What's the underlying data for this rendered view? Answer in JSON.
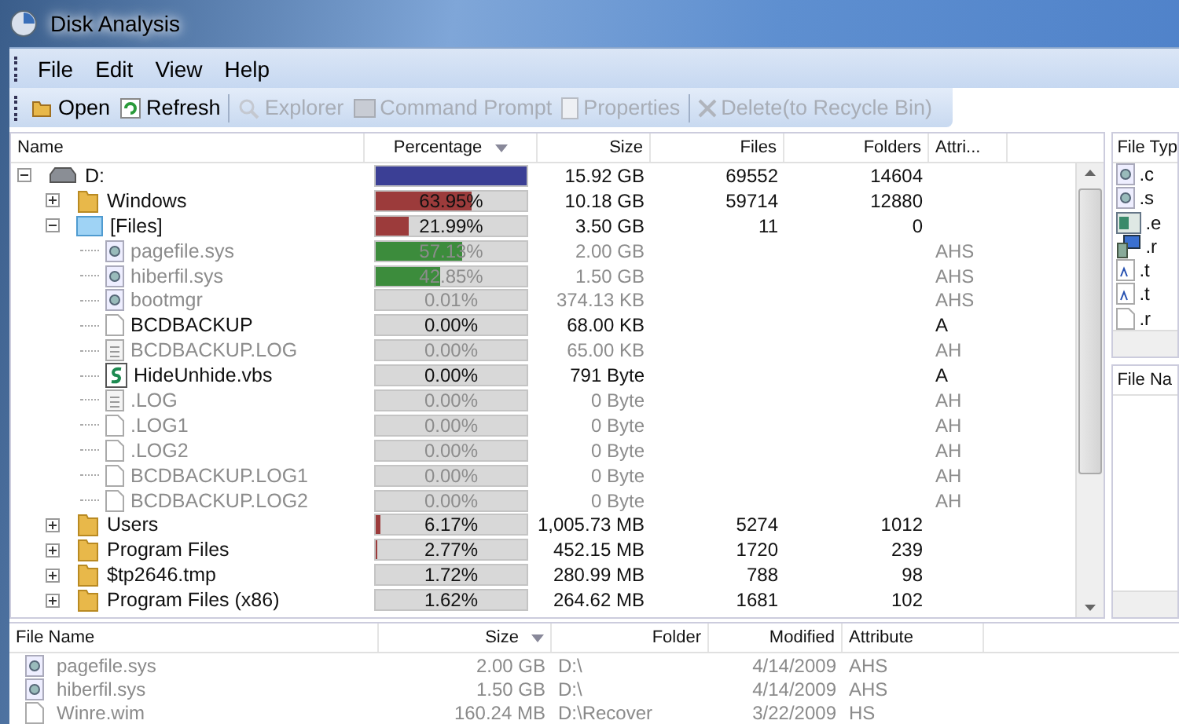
{
  "window": {
    "title": "Disk Analysis"
  },
  "menu": [
    "File",
    "Edit",
    "View",
    "Help"
  ],
  "toolbar": [
    {
      "label": "Open",
      "kind": "open",
      "disabled": false
    },
    {
      "label": "Refresh",
      "kind": "refresh",
      "disabled": false
    },
    {
      "label": "Explorer",
      "kind": "explorer",
      "disabled": true
    },
    {
      "label": "Command Prompt",
      "kind": "console",
      "disabled": true
    },
    {
      "label": "Properties",
      "kind": "properties",
      "disabled": true
    },
    {
      "label": "Delete(to Recycle Bin)",
      "kind": "delete",
      "disabled": true
    }
  ],
  "tree": {
    "columns": [
      "Name",
      "Percentage",
      "Size",
      "Files",
      "Folders",
      "Attri..."
    ],
    "items": [
      {
        "name": "D:",
        "kind": "drive",
        "expanded": true,
        "level": 1,
        "color": "#3b3f95",
        "size": "15.92 GB",
        "files": "69552",
        "folders": "14604",
        "dimmed": false,
        "children": [
          {
            "name": "Windows",
            "kind": "folder",
            "expanded": false,
            "percentage": "63.95%",
            "level": 0.64,
            "color": "#9c3b3b",
            "size": "10.18 GB",
            "files": "59714",
            "folders": "12880",
            "dimmed": false
          },
          {
            "name": "[Files]",
            "kind": "files-folder",
            "expanded": true,
            "percentage": "21.99%",
            "level": 0.22,
            "color": "#9c3b3b",
            "size": "3.50 GB",
            "files": "11",
            "folders": "0",
            "dimmed": false,
            "children": [
              {
                "name": "pagefile.sys",
                "kind": "system-file",
                "percentage": "57.13%",
                "level": 0.57,
                "color": "#3c8c3c",
                "size": "2.00 GB",
                "attributes": "AHS",
                "dimmed": true
              },
              {
                "name": "hiberfil.sys",
                "kind": "system-file",
                "percentage": "42.85%",
                "level": 0.43,
                "color": "#3c8c3c",
                "size": "1.50 GB",
                "attributes": "AHS",
                "dimmed": true
              },
              {
                "name": "bootmgr",
                "kind": "system-file",
                "percentage": "0.01%",
                "size": "374.13 KB",
                "attributes": "AHS",
                "dimmed": true
              },
              {
                "name": "BCDBACKUP",
                "kind": "file",
                "percentage": "0.00%",
                "size": "68.00 KB",
                "attributes": "A",
                "dimmed": false
              },
              {
                "name": "BCDBACKUP.LOG",
                "kind": "log-file",
                "percentage": "0.00%",
                "size": "65.00 KB",
                "attributes": "AH",
                "dimmed": true
              },
              {
                "name": "HideUnhide.vbs",
                "kind": "script",
                "percentage": "0.00%",
                "size": "791 Byte",
                "attributes": "A",
                "dimmed": false
              },
              {
                "name": ".LOG",
                "kind": "log-file",
                "percentage": "0.00%",
                "size": "0 Byte",
                "attributes": "AH",
                "dimmed": true
              },
              {
                "name": ".LOG1",
                "kind": "file",
                "percentage": "0.00%",
                "size": "0 Byte",
                "attributes": "AH",
                "dimmed": true
              },
              {
                "name": ".LOG2",
                "kind": "file",
                "percentage": "0.00%",
                "size": "0 Byte",
                "attributes": "AH",
                "dimmed": true
              },
              {
                "name": "BCDBACKUP.LOG1",
                "kind": "file",
                "percentage": "0.00%",
                "size": "0 Byte",
                "attributes": "AH",
                "dimmed": true
              },
              {
                "name": "BCDBACKUP.LOG2",
                "kind": "file",
                "percentage": "0.00%",
                "size": "0 Byte",
                "attributes": "AH",
                "dimmed": true
              }
            ]
          },
          {
            "name": "Users",
            "kind": "folder",
            "expanded": false,
            "percentage": "6.17%",
            "level": 0.03,
            "color": "#9c3b3b",
            "size": "1,005.73 MB",
            "files": "5274",
            "folders": "1012",
            "dimmed": false
          },
          {
            "name": "Program Files",
            "kind": "folder",
            "expanded": false,
            "percentage": "2.77%",
            "level": 0.01,
            "color": "#9c3b3b",
            "size": "452.15 MB",
            "files": "1720",
            "folders": "239",
            "dimmed": false
          },
          {
            "name": "$tp2646.tmp",
            "kind": "folder",
            "expanded": false,
            "percentage": "1.72%",
            "size": "280.99 MB",
            "files": "788",
            "folders": "98",
            "dimmed": false
          },
          {
            "name": "Program Files (x86)",
            "kind": "folder",
            "expanded": false,
            "percentage": "1.62%",
            "size": "264.62 MB",
            "files": "1681",
            "folders": "102",
            "dimmed": false
          }
        ]
      }
    ]
  },
  "file_types": {
    "header": "File Typ",
    "items": [
      {
        "label": ".c",
        "kind": "search-doc"
      },
      {
        "label": ".s",
        "kind": "search-doc"
      },
      {
        "label": ".e",
        "kind": "window"
      },
      {
        "label": ".r",
        "kind": "setup"
      },
      {
        "label": ".t",
        "kind": "text"
      },
      {
        "label": ".t",
        "kind": "text"
      },
      {
        "label": ".r",
        "kind": "blank"
      }
    ]
  },
  "file_names": {
    "header": "File Na"
  },
  "file_list": {
    "columns": [
      "File Name",
      "Size",
      "Folder",
      "Modified",
      "Attribute"
    ],
    "rows": [
      {
        "name": "pagefile.sys",
        "kind": "system-file",
        "size": "2.00 GB",
        "folder": "D:\\",
        "modified": "4/14/2009",
        "attribute": "AHS"
      },
      {
        "name": "hiberfil.sys",
        "kind": "system-file",
        "size": "1.50 GB",
        "folder": "D:\\",
        "modified": "4/14/2009",
        "attribute": "AHS"
      },
      {
        "name": "Winre.wim",
        "kind": "file",
        "size": "160.24 MB",
        "folder": "D:\\Recover",
        "modified": "3/22/2009",
        "attribute": "HS"
      }
    ]
  }
}
